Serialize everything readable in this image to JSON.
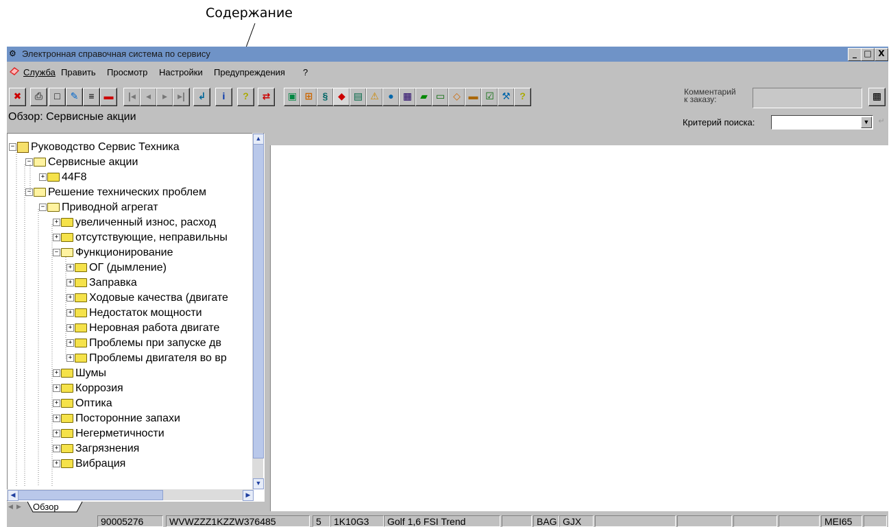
{
  "annotation": {
    "label": "Содержание"
  },
  "window": {
    "title": "Электронная справочная система по сервису",
    "controls": {
      "minimize": "_",
      "maximize": "□",
      "close": "X"
    }
  },
  "menu": [
    "Служба",
    "Править",
    "Просмотр",
    "Настройки",
    "Предупреждения",
    "?"
  ],
  "toolbar": {
    "comment_label_line1": "Комментарий",
    "comment_label_line2": "к заказу:",
    "comment_value": ""
  },
  "overview": {
    "title": "Обзор: Сервисные акции",
    "search_label": "Критерий поиска:",
    "search_value": ""
  },
  "tree": {
    "root": "Руководство Сервис Техника",
    "nodes": [
      "Сервисные акции",
      "44F8",
      "Решение технических проблем",
      "Приводной агрегат",
      "увеличенный износ, расход",
      "отсутствующие, неправильны",
      "Функционирование",
      "ОГ (дымление)",
      "Заправка",
      "Ходовые качества (двигате",
      "Недостаток мощности",
      "Неровная работа двигате",
      "Проблемы при запуске дв",
      "Проблемы двигателя во вр",
      "Шумы",
      "Коррозия",
      "Оптика",
      "Посторонние запахи",
      "Негерметичности",
      "Загрязнения",
      "Вибрация"
    ]
  },
  "tabs": {
    "overview": "Обзор"
  },
  "status": [
    "90005276",
    "WVWZZZ1KZZW376485",
    "5",
    "1K10G3",
    "Golf 1,6 FSI Trend",
    "",
    "BAG",
    "GJX",
    "",
    "",
    "",
    "",
    "MEI65",
    ""
  ]
}
